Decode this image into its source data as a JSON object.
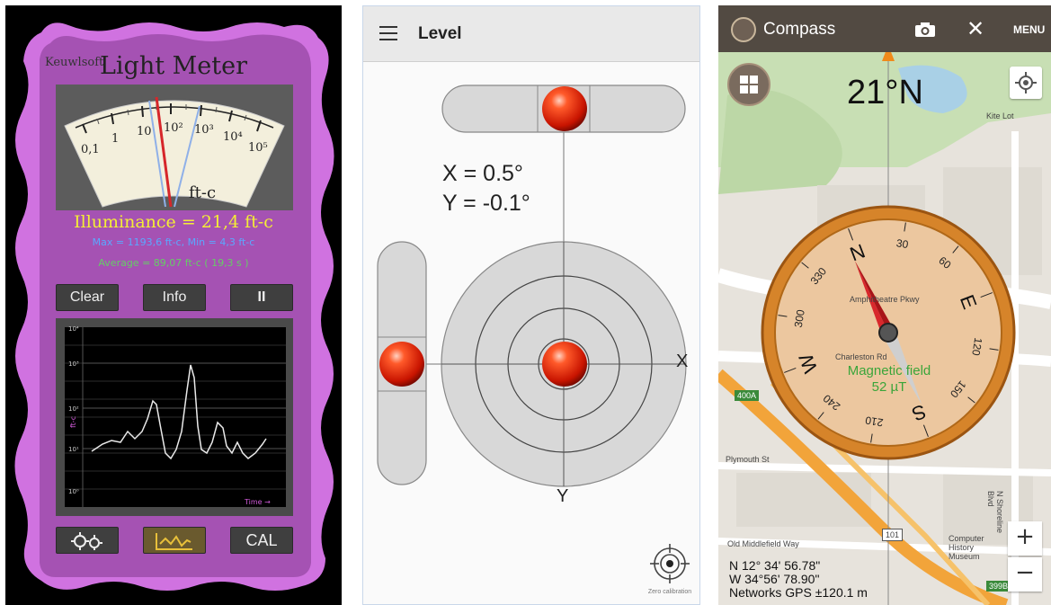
{
  "light_meter": {
    "brand": "Keuwlsoft",
    "title": "Light Meter",
    "gauge": {
      "scale_labels": [
        "0,1",
        "1",
        "10",
        "10²",
        "10³",
        "10⁴",
        "10⁵"
      ],
      "unit": "ft-c"
    },
    "illuminance": "Illuminance = 21,4 ft-c",
    "max_min": "Max = 1193,6 ft-c, Min = 4,3 ft-c",
    "average": "Average = 89,07 ft-c ( 19,3 s )",
    "buttons": {
      "clear": "Clear",
      "info": "Info",
      "pause": "II",
      "cal": "CAL"
    },
    "graph": {
      "y_ticks": [
        "10⁴",
        "10³",
        "10²",
        "10¹",
        "10⁰"
      ],
      "y_axis_label": "ft-c",
      "x_axis_label": "Time →"
    },
    "colors": {
      "body": "#b45ac4",
      "border": "#d676e6",
      "yellow": "#f4ee35",
      "blue": "#5aa8ff",
      "green": "#66cc66"
    },
    "icons": {
      "settings": "gear-icon",
      "graph": "graph-icon"
    }
  },
  "level": {
    "appbar": {
      "title": "Level",
      "menu_icon": "hamburger-icon"
    },
    "x_reading": "X = 0.5°",
    "y_reading": "Y = -0.1°",
    "axis_x": "X",
    "axis_y": "Y",
    "zero_calibration": "Zero calibration"
  },
  "compass": {
    "topbar": {
      "title": "Compass",
      "menu": "MENU"
    },
    "heading": "21°N",
    "dial": {
      "cardinals": [
        "N",
        "E",
        "S",
        "W"
      ],
      "degree_labels": [
        "30",
        "60",
        "120",
        "150",
        "210",
        "240",
        "300",
        "330"
      ]
    },
    "magnetic_field_label": "Magnetic field",
    "magnetic_field_value": "52 µT",
    "coords": {
      "lat": "N 12° 34' 56.78\"",
      "lon": "W 34°56' 78.90\"",
      "gps": "Networks GPS ±120.1 m"
    },
    "map_labels": {
      "kite_lot": "Kite Lot",
      "amphitheatre": "Amphitheatre Pkwy",
      "charleston": "Charleston Rd",
      "plymouth": "Plymouth St",
      "old_middlefield": "Old Middlefield Way",
      "museum": "Computer History Museum",
      "shoreline": "N Shoreline Blvd",
      "route_400a": "400A",
      "route_101": "101",
      "route_399b": "399B"
    },
    "zoom_in": "+",
    "zoom_out": "−"
  }
}
